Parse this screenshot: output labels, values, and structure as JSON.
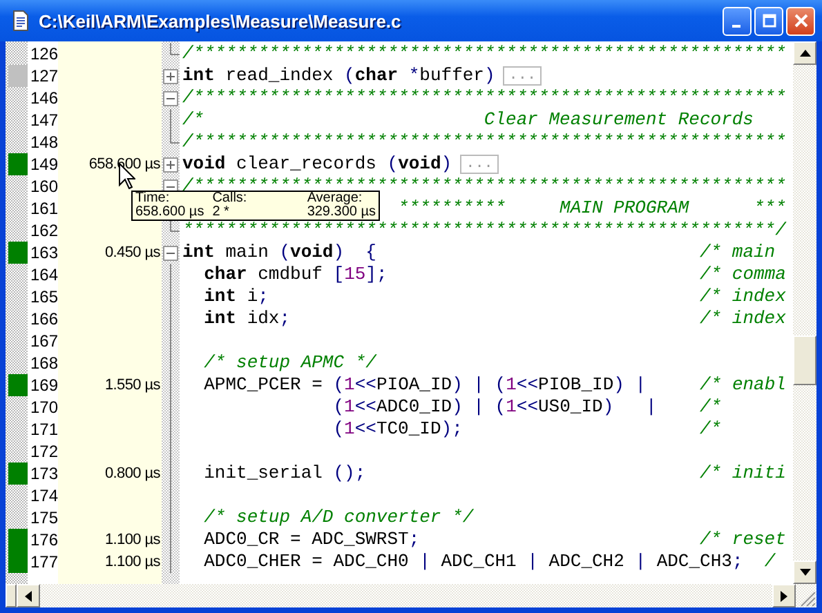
{
  "window": {
    "title": "C:\\Keil\\ARM\\Examples\\Measure\\Measure.c"
  },
  "lines": [
    {
      "number": "126",
      "segments": [
        {
          "kind": "cmt",
          "text": "/*******************************************************"
        }
      ]
    },
    {
      "number": "127",
      "color": "#c0c0c0",
      "foldable": true,
      "expanded": false,
      "segments": [
        {
          "kind": "kw",
          "text": "int"
        },
        {
          "kind": "id",
          "text": " read_index "
        },
        {
          "kind": "punct",
          "text": "("
        },
        {
          "kind": "kw",
          "text": "char"
        },
        {
          "kind": "punct",
          "text": " *"
        },
        {
          "kind": "id",
          "text": "buffer"
        },
        {
          "kind": "punct",
          "text": ")"
        }
      ],
      "collapsed": "..."
    },
    {
      "number": "146",
      "foldable": true,
      "expanded": true,
      "segments": [
        {
          "kind": "cmt",
          "text": "/*******************************************************"
        }
      ]
    },
    {
      "number": "147",
      "segments": [
        {
          "kind": "cmt",
          "text": "/*                          Clear Measurement Records"
        }
      ]
    },
    {
      "number": "148",
      "segments": [
        {
          "kind": "cmt",
          "text": "/*******************************************************"
        }
      ]
    },
    {
      "number": "149",
      "color": "#008000",
      "time": "658.600 µs",
      "foldable": true,
      "expanded": false,
      "segments": [
        {
          "kind": "kw",
          "text": "void"
        },
        {
          "kind": "id",
          "text": " clear_records "
        },
        {
          "kind": "punct",
          "text": "("
        },
        {
          "kind": "kw",
          "text": "void"
        },
        {
          "kind": "punct",
          "text": ")"
        }
      ],
      "collapsed": "..."
    },
    {
      "number": "160",
      "foldable": true,
      "expanded": true,
      "segments": [
        {
          "kind": "cmt",
          "text": "/*******************************************************"
        }
      ]
    },
    {
      "number": "161",
      "segments": [
        {
          "kind": "cmt",
          "text": "                    **********     MAIN PROGRAM      ***"
        }
      ]
    },
    {
      "number": "162",
      "segments": [
        {
          "kind": "cmt",
          "text": "*******************************************************/"
        }
      ]
    },
    {
      "number": "163",
      "color": "#008000",
      "time": "0.450 µs",
      "foldable": true,
      "expanded": true,
      "segments": [
        {
          "kind": "kw",
          "text": "int"
        },
        {
          "kind": "id",
          "text": " main "
        },
        {
          "kind": "punct",
          "text": "("
        },
        {
          "kind": "kw",
          "text": "void"
        },
        {
          "kind": "punct",
          "text": ")  {                              "
        },
        {
          "kind": "cmt",
          "text": "/* main"
        }
      ]
    },
    {
      "number": "164",
      "segments": [
        {
          "kind": "kw",
          "text": "  char"
        },
        {
          "kind": "id",
          "text": " cmdbuf "
        },
        {
          "kind": "punct",
          "text": "["
        },
        {
          "kind": "num",
          "text": "15"
        },
        {
          "kind": "punct",
          "text": "];                             "
        },
        {
          "kind": "cmt",
          "text": "/* comma"
        }
      ]
    },
    {
      "number": "165",
      "segments": [
        {
          "kind": "kw",
          "text": "  int"
        },
        {
          "kind": "id",
          "text": " i"
        },
        {
          "kind": "punct",
          "text": ";                                        "
        },
        {
          "kind": "cmt",
          "text": "/* index"
        }
      ]
    },
    {
      "number": "166",
      "segments": [
        {
          "kind": "kw",
          "text": "  int"
        },
        {
          "kind": "id",
          "text": " idx"
        },
        {
          "kind": "punct",
          "text": ";                                      "
        },
        {
          "kind": "cmt",
          "text": "/* index"
        }
      ]
    },
    {
      "number": "167"
    },
    {
      "number": "168",
      "segments": [
        {
          "kind": "cmt",
          "text": "  /* setup APMC */"
        }
      ]
    },
    {
      "number": "169",
      "color": "#008000",
      "time": "1.550 µs",
      "segments": [
        {
          "kind": "id",
          "text": "  APMC_PCER = "
        },
        {
          "kind": "punct",
          "text": "("
        },
        {
          "kind": "num",
          "text": "1"
        },
        {
          "kind": "punct",
          "text": "<<"
        },
        {
          "kind": "id",
          "text": "PIOA_ID"
        },
        {
          "kind": "punct",
          "text": ") | ("
        },
        {
          "kind": "num",
          "text": "1"
        },
        {
          "kind": "punct",
          "text": "<<"
        },
        {
          "kind": "id",
          "text": "PIOB_ID"
        },
        {
          "kind": "punct",
          "text": ") |     "
        },
        {
          "kind": "cmt",
          "text": "/* enabl"
        }
      ]
    },
    {
      "number": "170",
      "segments": [
        {
          "kind": "punct",
          "text": "              ("
        },
        {
          "kind": "num",
          "text": "1"
        },
        {
          "kind": "punct",
          "text": "<<"
        },
        {
          "kind": "id",
          "text": "ADC0_ID"
        },
        {
          "kind": "punct",
          "text": ") | ("
        },
        {
          "kind": "num",
          "text": "1"
        },
        {
          "kind": "punct",
          "text": "<<"
        },
        {
          "kind": "id",
          "text": "US0_ID"
        },
        {
          "kind": "punct",
          "text": ")   |    "
        },
        {
          "kind": "cmt",
          "text": "/*"
        }
      ]
    },
    {
      "number": "171",
      "segments": [
        {
          "kind": "punct",
          "text": "              ("
        },
        {
          "kind": "num",
          "text": "1"
        },
        {
          "kind": "punct",
          "text": "<<"
        },
        {
          "kind": "id",
          "text": "TC0_ID"
        },
        {
          "kind": "punct",
          "text": ");                      "
        },
        {
          "kind": "cmt",
          "text": "/*"
        }
      ]
    },
    {
      "number": "172"
    },
    {
      "number": "173",
      "color": "#008000",
      "time": "0.800 µs",
      "segments": [
        {
          "kind": "id",
          "text": "  init_serial "
        },
        {
          "kind": "punct",
          "text": "();                               "
        },
        {
          "kind": "cmt",
          "text": "/* initi"
        }
      ]
    },
    {
      "number": "174"
    },
    {
      "number": "175",
      "segments": [
        {
          "kind": "cmt",
          "text": "  /* setup A/D converter */"
        }
      ]
    },
    {
      "number": "176",
      "color": "#008000",
      "time": "1.100 µs",
      "segments": [
        {
          "kind": "id",
          "text": "  ADC0_CR = ADC_SWRST"
        },
        {
          "kind": "punct",
          "text": ";                          "
        },
        {
          "kind": "cmt",
          "text": "/* reset"
        }
      ]
    },
    {
      "number": "177",
      "color": "#008000",
      "time": "1.100 µs",
      "segments": [
        {
          "kind": "id",
          "text": "  ADC0_CHER = ADC_CH0 "
        },
        {
          "kind": "punct",
          "text": "|"
        },
        {
          "kind": "id",
          "text": " ADC_CH1 "
        },
        {
          "kind": "punct",
          "text": "|"
        },
        {
          "kind": "id",
          "text": " ADC_CH2 "
        },
        {
          "kind": "punct",
          "text": "|"
        },
        {
          "kind": "id",
          "text": " ADC_CH3"
        },
        {
          "kind": "punct",
          "text": ";  "
        },
        {
          "kind": "cmt",
          "text": "/"
        }
      ]
    }
  ],
  "tooltip": {
    "columns": [
      {
        "label": "Time:",
        "value": "658.600 µs"
      },
      {
        "label": "Calls:",
        "value": "2 *"
      },
      {
        "label": "Average:",
        "value": "329.300 µs"
      }
    ]
  }
}
